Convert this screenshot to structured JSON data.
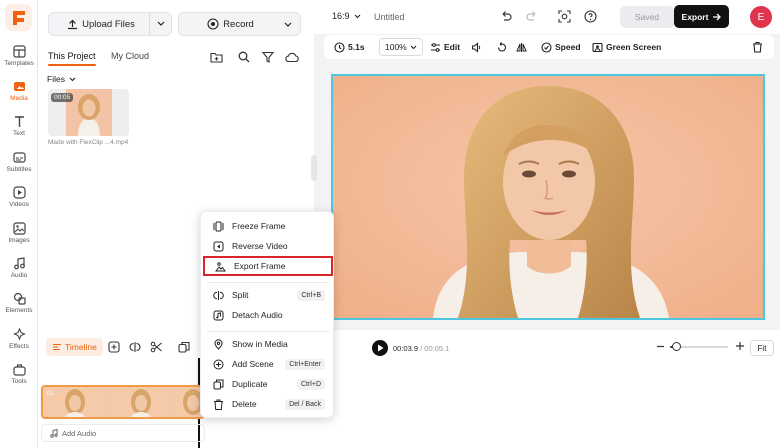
{
  "colors": {
    "accent": "#f0620f",
    "canvas_border": "#4fc6e0",
    "highlight": "#d8262c",
    "avatar": "#e0334d"
  },
  "rail": {
    "items": [
      {
        "label": "Templates",
        "icon": "templates-icon"
      },
      {
        "label": "Media",
        "icon": "media-icon",
        "active": true
      },
      {
        "label": "Text",
        "icon": "text-icon"
      },
      {
        "label": "Subtitles",
        "icon": "subtitles-icon"
      },
      {
        "label": "Videos",
        "icon": "videos-icon"
      },
      {
        "label": "Images",
        "icon": "images-icon"
      },
      {
        "label": "Audio",
        "icon": "audio-icon"
      },
      {
        "label": "Elements",
        "icon": "elements-icon"
      },
      {
        "label": "Effects",
        "icon": "effects-icon"
      },
      {
        "label": "Tools",
        "icon": "tools-icon"
      }
    ]
  },
  "panel": {
    "upload_label": "Upload Files",
    "record_label": "Record",
    "tabs": [
      "This Project",
      "My Cloud"
    ],
    "files_label": "Files",
    "file": {
      "duration": "00:05",
      "name": "Made with FlexClip ...4.mp4"
    }
  },
  "topbar": {
    "aspect": "16:9",
    "title": "Untitled",
    "saved_label": "Saved",
    "export_label": "Export",
    "avatar_letter": "E"
  },
  "toolbar": {
    "duration": "5.1s",
    "zoom": "100%",
    "edit_label": "Edit",
    "speed_label": "Speed",
    "green_screen_label": "Green Screen"
  },
  "timeline": {
    "label": "Timeline",
    "current_time": "00:03.9",
    "total_time": "/ 00:05.1",
    "fit_label": "Fit",
    "add_audio_label": "Add Audio",
    "clip_index": "01",
    "zoom_level": 0.1
  },
  "context_menu": {
    "items": [
      {
        "label": "Freeze Frame",
        "icon": "freeze-frame-icon",
        "shortcut": ""
      },
      {
        "label": "Reverse Video",
        "icon": "reverse-video-icon",
        "shortcut": ""
      },
      {
        "label": "Export Frame",
        "icon": "export-frame-icon",
        "shortcut": "",
        "highlighted": true
      },
      {
        "label": "Split",
        "icon": "split-icon",
        "shortcut": "Ctrl+B"
      },
      {
        "label": "Detach Audio",
        "icon": "detach-audio-icon",
        "shortcut": ""
      },
      {
        "label": "Show in Media",
        "icon": "show-in-media-icon",
        "shortcut": ""
      },
      {
        "label": "Add Scene",
        "icon": "add-scene-icon",
        "shortcut": "Ctrl+Enter"
      },
      {
        "label": "Duplicate",
        "icon": "duplicate-icon",
        "shortcut": "Ctrl+D"
      },
      {
        "label": "Delete",
        "icon": "delete-icon",
        "shortcut": "Del / Back"
      }
    ]
  }
}
